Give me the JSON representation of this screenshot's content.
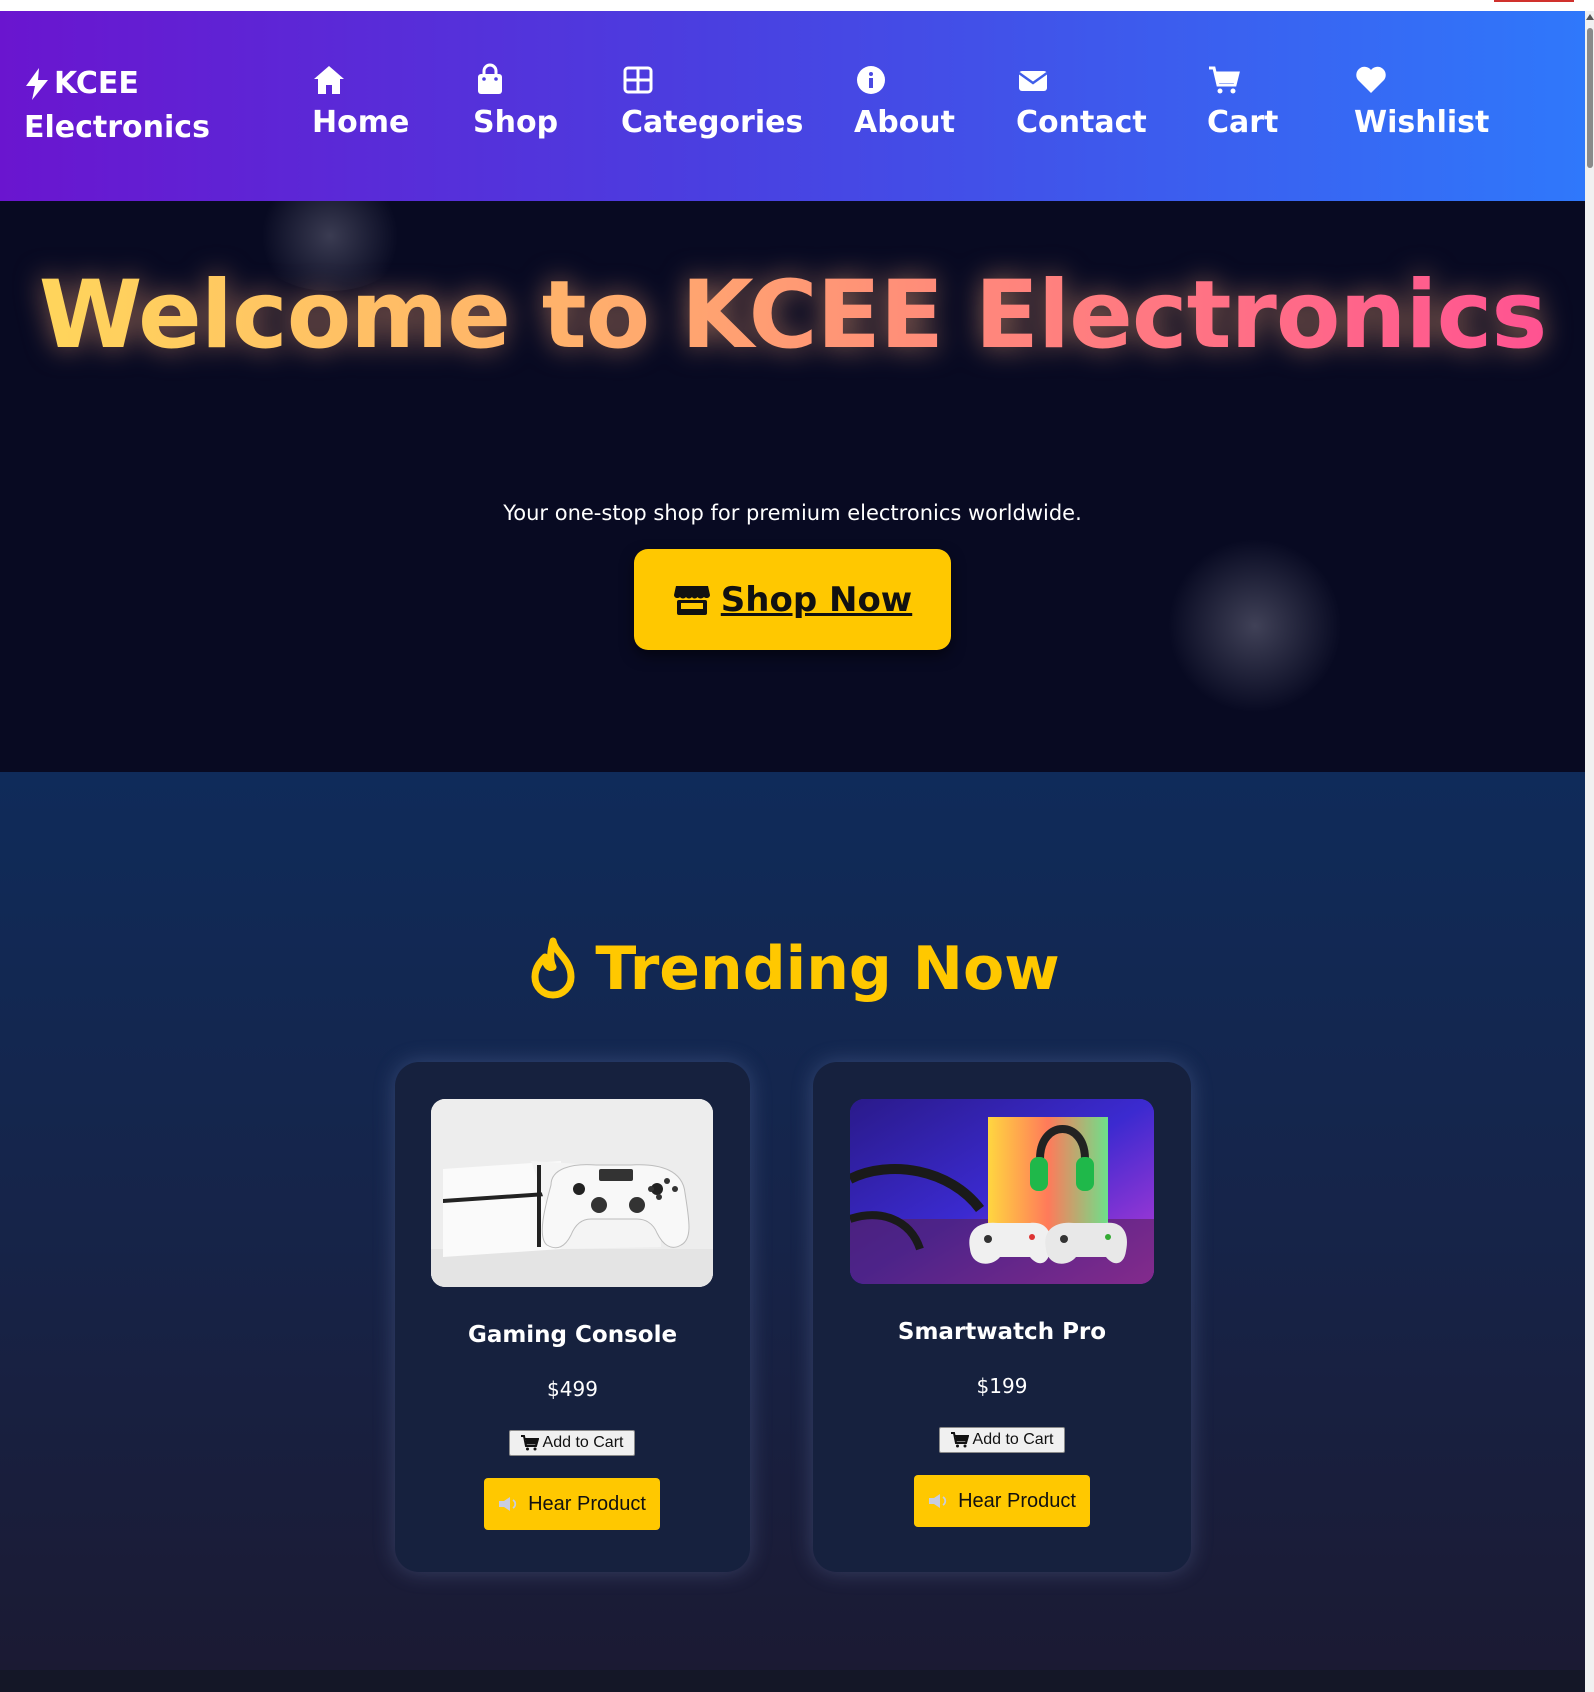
{
  "brand": {
    "line1": "KCEE",
    "line2": "Electronics"
  },
  "nav": {
    "home": "Home",
    "shop": "Shop",
    "categories": "Categories",
    "about": "About",
    "contact": "Contact",
    "cart": "Cart",
    "wishlist": "Wishlist"
  },
  "hero": {
    "title": "Welcome to KCEE Electronics",
    "subtitle": "Your one-stop shop for premium electronics worldwide.",
    "cta": "Shop Now"
  },
  "trending": {
    "title": "Trending Now",
    "products": [
      {
        "name": "Gaming Console",
        "price": "$499",
        "add_to_cart": "Add to Cart",
        "hear": "Hear Product"
      },
      {
        "name": "Smartwatch Pro",
        "price": "$199",
        "add_to_cart": "Add to Cart",
        "hear": "Hear Product"
      }
    ]
  },
  "colors": {
    "accent": "#ffc800",
    "nav_gradient_start": "#6a15cf",
    "nav_gradient_end": "#2f78fb",
    "hero_bg": "#080a22",
    "card_bg": "#16213e"
  }
}
